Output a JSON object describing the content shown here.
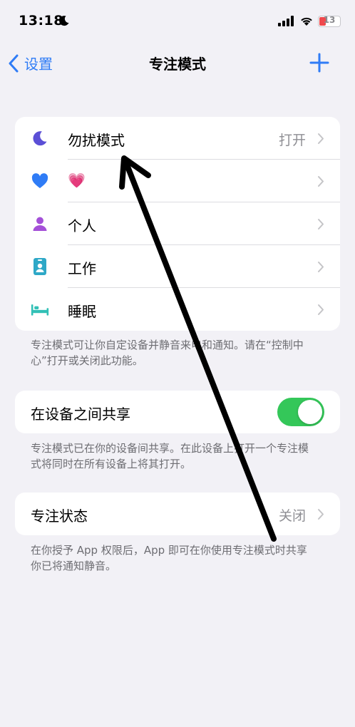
{
  "status_bar": {
    "time": "13:18",
    "battery": "13"
  },
  "nav": {
    "back_label": "设置",
    "title": "专注模式"
  },
  "focus_modes": [
    {
      "icon": "moon-icon",
      "label": "勿扰模式",
      "value": "打开"
    },
    {
      "icon": "heart-icon",
      "label": "💗",
      "value": ""
    },
    {
      "icon": "person-icon",
      "label": "个人",
      "value": ""
    },
    {
      "icon": "id-badge-icon",
      "label": "工作",
      "value": ""
    },
    {
      "icon": "bed-icon",
      "label": "睡眠",
      "value": ""
    }
  ],
  "focus_footnote": "专注模式可让你自定设备并静音来电和通知。请在“控制中心”打开或关闭此功能。",
  "share": {
    "label": "在设备之间共享",
    "enabled": true,
    "footnote": "专注模式已在你的设备间共享。在此设备上打开一个专注模式将同时在所有设备上将其打开。"
  },
  "focus_status": {
    "label": "专注状态",
    "value": "关闭",
    "footnote": "在你授予 App 权限后，App 即可在你使用专注模式时共享你已将通知静音。"
  },
  "colors": {
    "accent": "#2f7cf6",
    "toggle_on": "#34c759",
    "moon": "#5b4fd6",
    "heart": "#2f7cf6",
    "person": "#a450d8",
    "work": "#2ea8c7",
    "bed": "#32c0b6"
  }
}
